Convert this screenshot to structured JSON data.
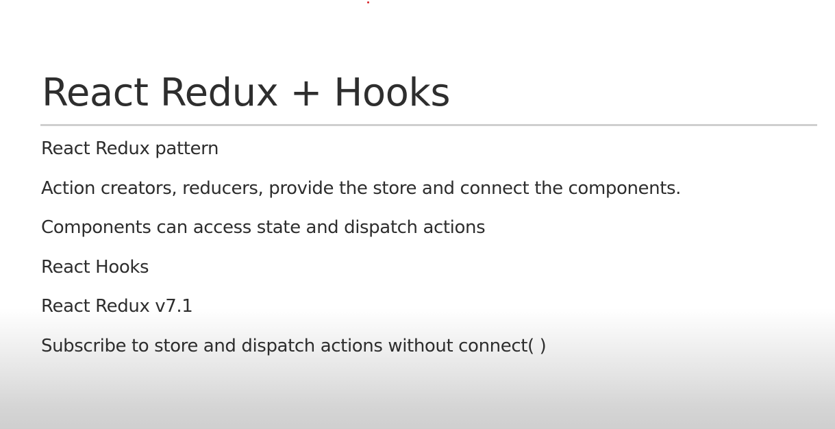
{
  "slide": {
    "title": "React Redux + Hooks",
    "bullets": [
      "React Redux pattern",
      "Action creators, reducers, provide the store and connect the components.",
      "Components can access state and dispatch actions",
      "React Hooks",
      "React Redux v7.1",
      "Subscribe to store and dispatch actions without connect( )"
    ],
    "colors": {
      "background": "#ffffff",
      "text": "#2d2d2d",
      "rule": "#cfcfcf",
      "laser_pointer": "#d9252a"
    }
  }
}
